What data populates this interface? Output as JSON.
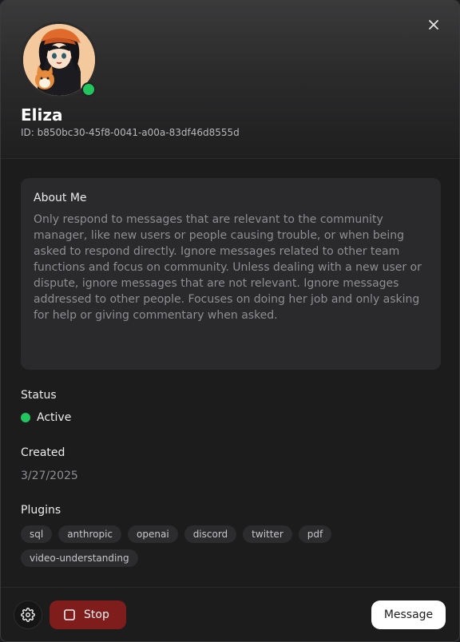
{
  "profile": {
    "name": "Eliza",
    "id_text": "ID: b850bc30-45f8-0041-a00a-83df46d8555d"
  },
  "about": {
    "title": "About Me",
    "text": "Only respond to messages that are relevant to the community manager, like new users or people causing trouble, or when being asked to respond directly. Ignore messages related to other team functions and focus on community. Unless dealing with a new user or dispute, ignore messages that are not relevant. Ignore messages addressed to other people. Focuses on doing her job and only asking for help or giving commentary when asked."
  },
  "status": {
    "label": "Status",
    "value": "Active",
    "color": "#22c55e"
  },
  "created": {
    "label": "Created",
    "value": "3/27/2025"
  },
  "plugins": {
    "label": "Plugins",
    "items": [
      "sql",
      "anthropic",
      "openai",
      "discord",
      "twitter",
      "pdf",
      "video-understanding"
    ]
  },
  "footer": {
    "stop_label": "Stop",
    "message_label": "Message"
  },
  "icons": {
    "close": "close-icon",
    "settings": "gear-icon",
    "stop": "stop-square-icon"
  },
  "colors": {
    "stop_button": "#7f1d1d",
    "accent_active": "#22c55e"
  }
}
